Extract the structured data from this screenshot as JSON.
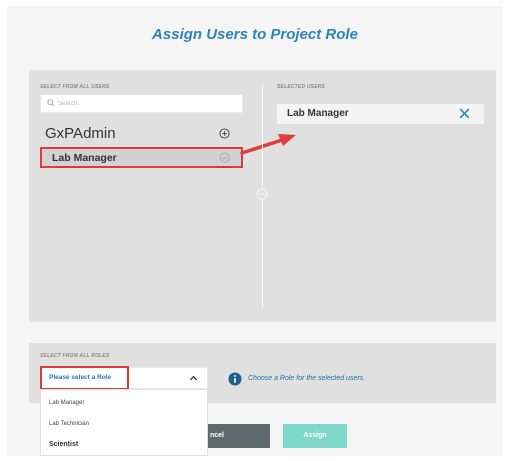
{
  "dialog": {
    "title": "Assign Users to Project Role"
  },
  "users_panel": {
    "all_users_caption": "SELECT FROM ALL USERS",
    "search_placeholder": "Search...",
    "users": [
      {
        "name": "GxPAdmin"
      },
      {
        "name": "Lab Manager",
        "selected": true
      }
    ],
    "selected_caption": "SELECTED USERS",
    "selected_users": [
      {
        "name": "Lab Manager"
      }
    ]
  },
  "roles_panel": {
    "caption": "SELECT FROM ALL ROLES",
    "select_value": "Please select a Role",
    "info_text": "Choose a Role for the selected users.",
    "options": [
      "Lab Manager",
      "Lab Technician",
      "Scientist"
    ]
  },
  "buttons": {
    "cancel_label": "ncel",
    "assign_label": "Assign"
  },
  "colors": {
    "title": "#2e84b8",
    "highlight": "#dc3a3a",
    "assign_button": "#7fd8cc",
    "cancel_button": "#5f6a6f",
    "info": "#1f6ea3"
  },
  "icons": [
    "search-icon",
    "add-circle-icon",
    "check-circle-icon",
    "close-icon",
    "chevron-up-icon",
    "info-icon",
    "arrow-icon"
  ]
}
